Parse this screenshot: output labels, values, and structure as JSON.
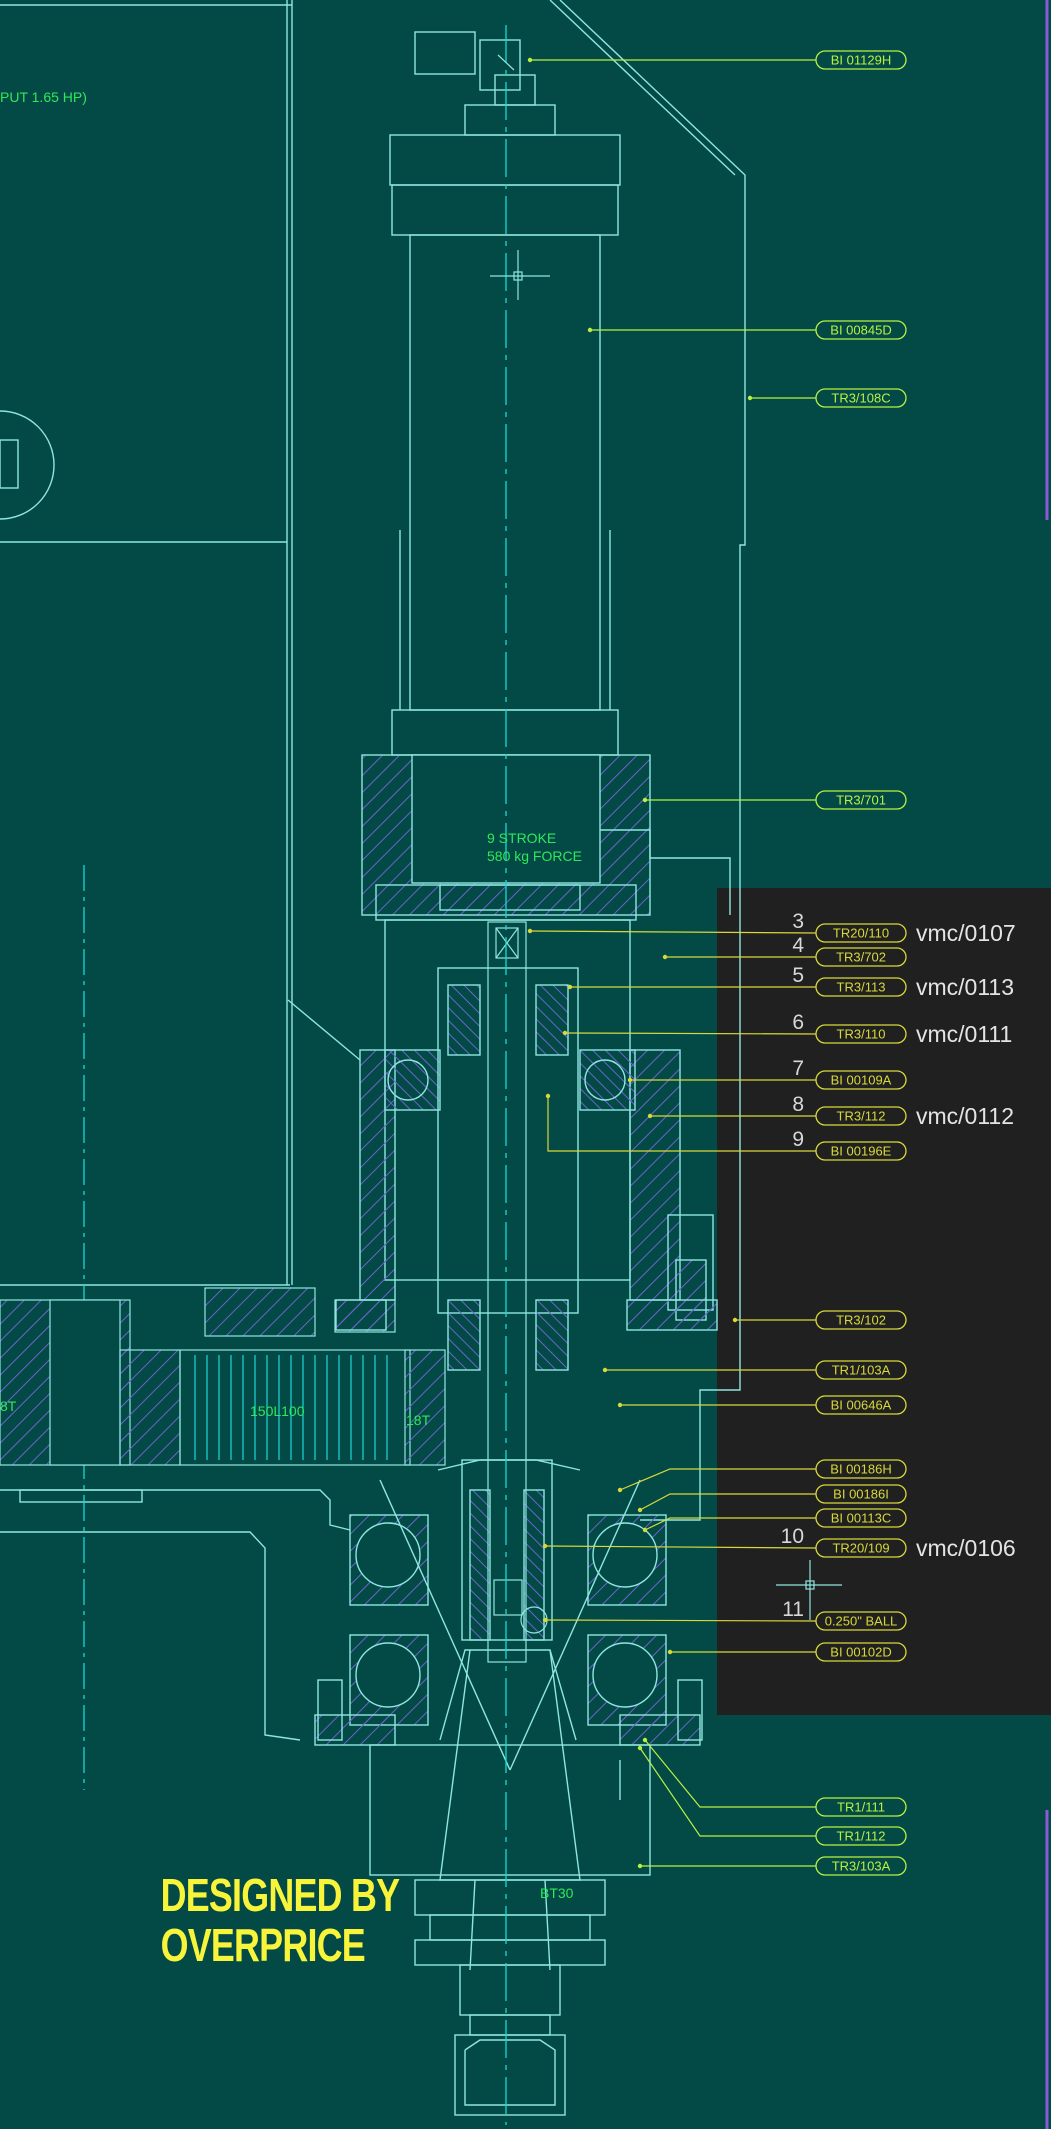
{
  "credit": {
    "line1": "DESIGNED BY",
    "line2": "OVERPRICE"
  },
  "notes": {
    "output_hp": "PUT 1.65 HP)",
    "stroke": "9 STROKE",
    "force": "580 kg FORCE",
    "belt": "150L100",
    "pulley_left": "8T",
    "pulley_right": "18T",
    "taper": "BT30"
  },
  "callouts": [
    {
      "tag": "BI 01129H",
      "num": "",
      "vmc": ""
    },
    {
      "tag": "BI 00845D",
      "num": "",
      "vmc": ""
    },
    {
      "tag": "TR3/108C",
      "num": "",
      "vmc": ""
    },
    {
      "tag": "TR3/701",
      "num": "",
      "vmc": ""
    },
    {
      "tag": "TR20/110",
      "num": "3",
      "vmc": "vmc/0107"
    },
    {
      "tag": "TR3/702",
      "num": "4",
      "vmc": ""
    },
    {
      "tag": "TR3/113",
      "num": "5",
      "vmc": "vmc/0113"
    },
    {
      "tag": "TR3/110",
      "num": "6",
      "vmc": "vmc/0111"
    },
    {
      "tag": "BI 00109A",
      "num": "7",
      "vmc": ""
    },
    {
      "tag": "TR3/112",
      "num": "8",
      "vmc": "vmc/0112"
    },
    {
      "tag": "BI 00196E",
      "num": "9",
      "vmc": ""
    },
    {
      "tag": "TR3/102",
      "num": "",
      "vmc": ""
    },
    {
      "tag": "TR1/103A",
      "num": "",
      "vmc": ""
    },
    {
      "tag": "BI 00646A",
      "num": "",
      "vmc": ""
    },
    {
      "tag": "BI 00186H",
      "num": "",
      "vmc": ""
    },
    {
      "tag": "BI 00186I",
      "num": "",
      "vmc": ""
    },
    {
      "tag": "BI 00113C",
      "num": "",
      "vmc": ""
    },
    {
      "tag": "TR20/109",
      "num": "10",
      "vmc": "vmc/0106"
    },
    {
      "tag": "0.250\" BALL",
      "num": "11",
      "vmc": ""
    },
    {
      "tag": "BI 00102D",
      "num": "",
      "vmc": ""
    },
    {
      "tag": "TR1/111",
      "num": "",
      "vmc": ""
    },
    {
      "tag": "TR1/112",
      "num": "",
      "vmc": ""
    },
    {
      "tag": "TR3/103A",
      "num": "",
      "vmc": ""
    }
  ],
  "colors": {
    "background": "#034a47",
    "panel": "#202020",
    "line": "#8fe6e0",
    "centerline": "#19d8d4",
    "leader_green": "#b8f040",
    "leader_yellow": "#d8d83a",
    "hatch": "#6a64c8",
    "label_green": "#2ee85a",
    "credit": "#f7f43a"
  }
}
